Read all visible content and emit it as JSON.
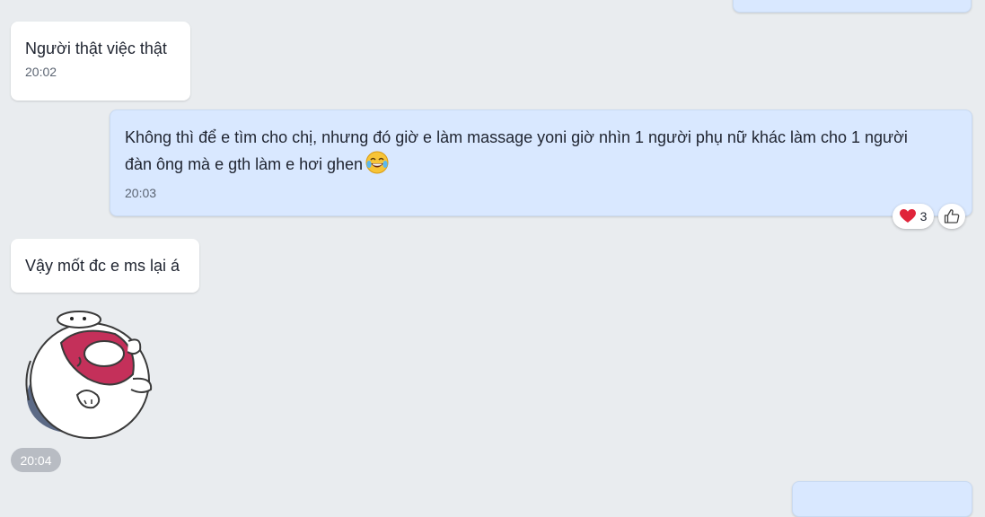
{
  "messages": [
    {
      "id": "m1",
      "side": "incoming",
      "text": "Người thật việc thật",
      "time": "20:02"
    },
    {
      "id": "m2",
      "side": "outgoing",
      "text_line1": "Không thì để e tìm cho chị, nhưng đó giờ e làm massage yoni giờ nhìn 1 người phụ nữ khác làm cho 1 người",
      "text_line2": "đàn ông mà e gth làm e hơi ghen",
      "emoji": "tears-of-joy-emoji",
      "time": "20:03",
      "reactions": {
        "icon": "heart-icon",
        "count": "3",
        "color": "#e0243a"
      }
    },
    {
      "id": "m3",
      "side": "incoming",
      "text": "Vậy mốt đc e ms lại á"
    },
    {
      "id": "m4",
      "side": "incoming",
      "type": "sticker",
      "sticker": "cat-rolling-sticker",
      "time": "20:04"
    }
  ],
  "colors": {
    "background": "#e9ecef",
    "incoming": "#ffffff",
    "outgoing": "#d9e8ff"
  }
}
